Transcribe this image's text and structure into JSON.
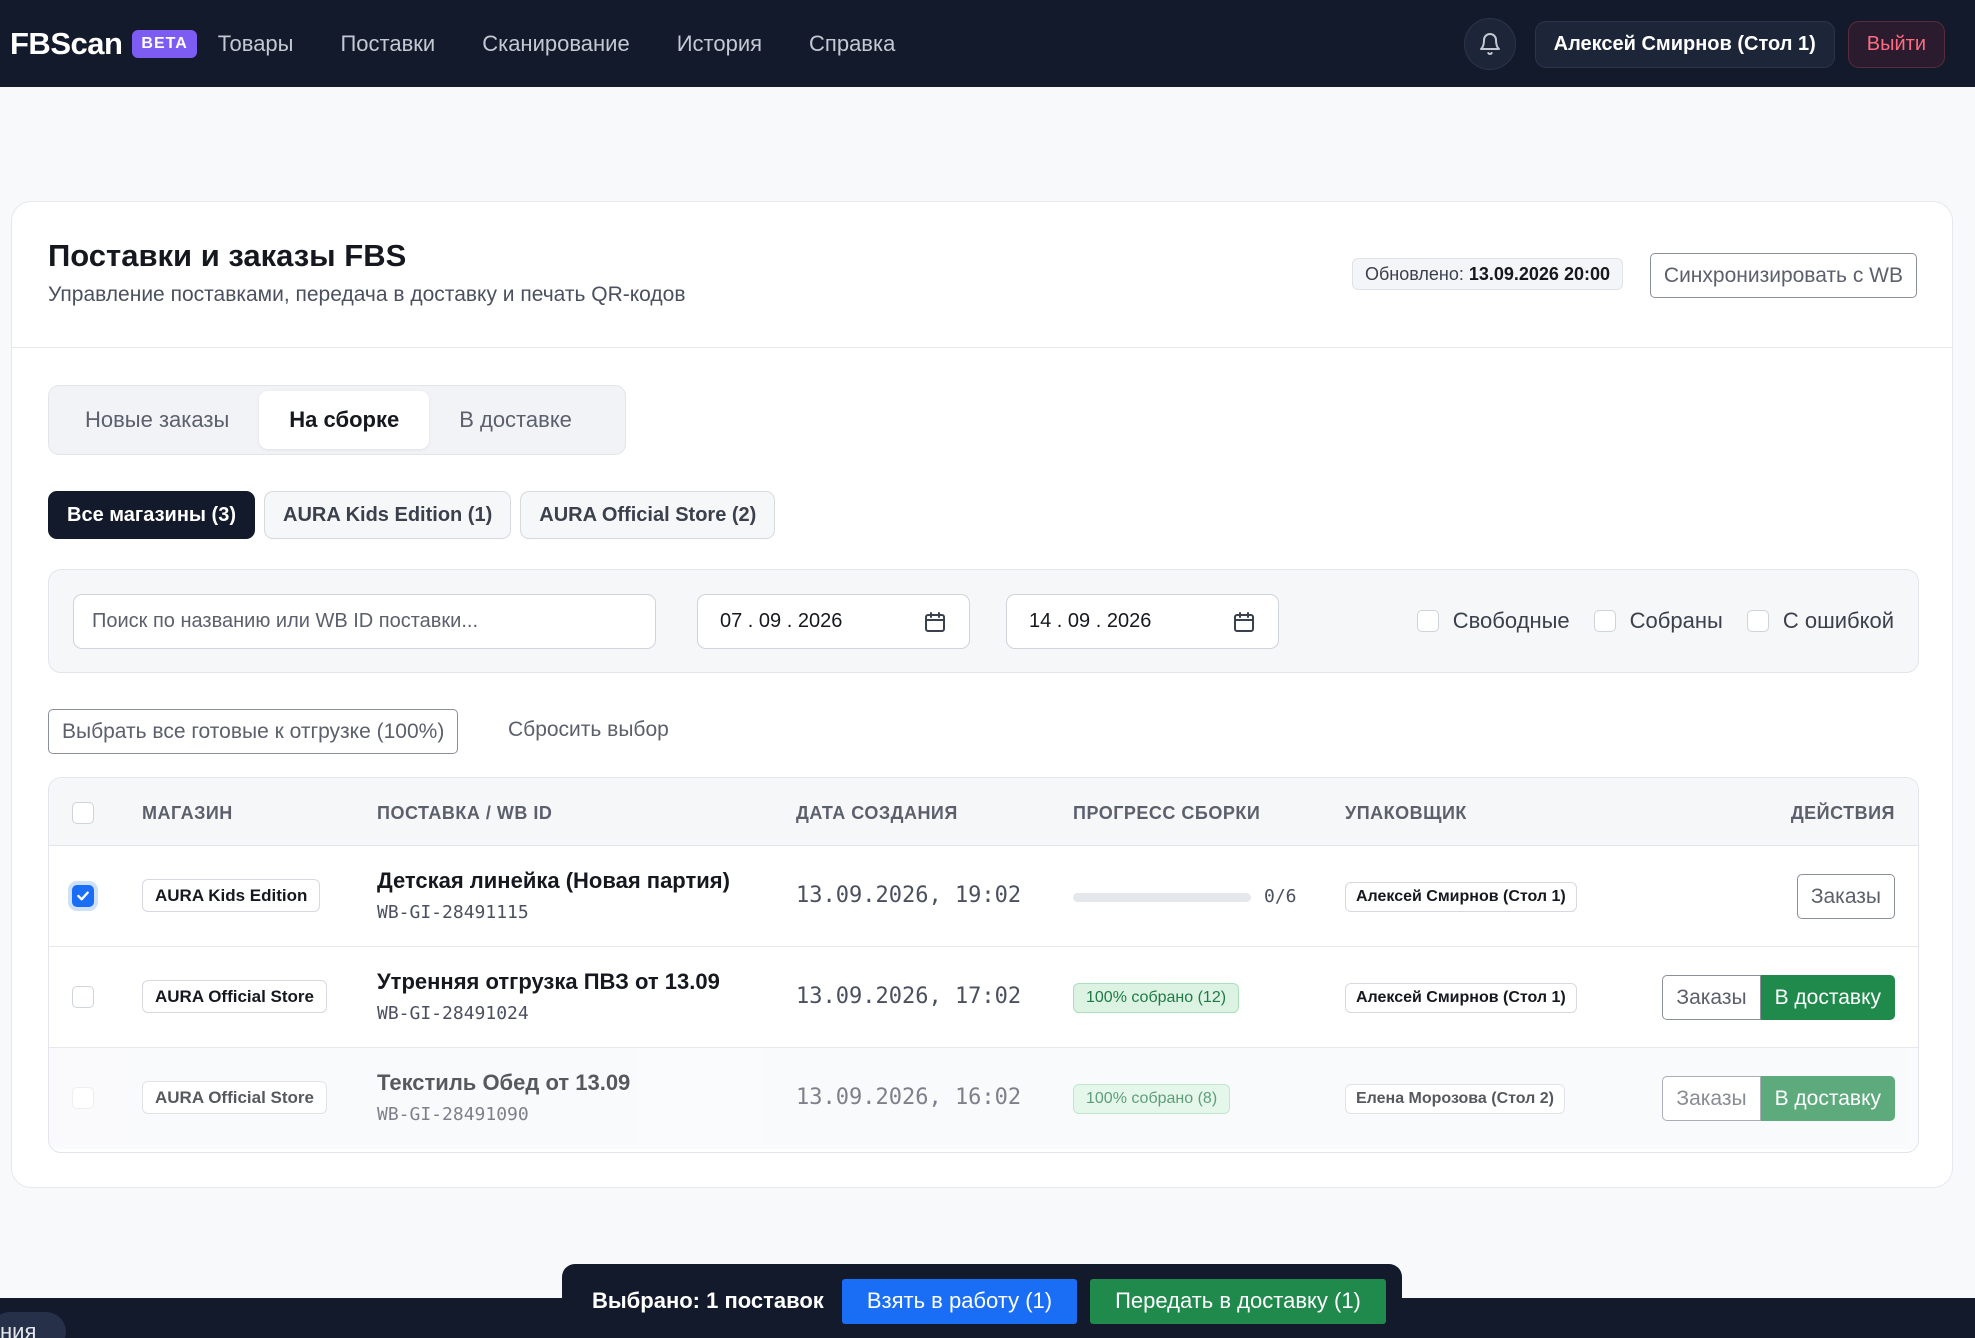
{
  "nav": {
    "brand": "FBScan",
    "beta": "BETA",
    "links": [
      "Товары",
      "Поставки",
      "Сканирование",
      "История",
      "Справка"
    ],
    "user": "Алексей Смирнов (Стол 1)",
    "logout": "Выйти"
  },
  "header": {
    "title": "Поставки и заказы FBS",
    "subtitle": "Управление поставками, передача в доставку и печать QR-кодов",
    "updated_label": "Обновлено:",
    "updated_value": "13.09.2026 20:00",
    "sync_button": "Синхронизировать с WB"
  },
  "tabs": [
    {
      "label": "Новые заказы",
      "active": false
    },
    {
      "label": "На сборке",
      "active": true
    },
    {
      "label": "В доставке",
      "active": false
    }
  ],
  "stores": [
    {
      "label": "Все магазины (3)",
      "active": true
    },
    {
      "label": "AURA Kids Edition (1)",
      "active": false
    },
    {
      "label": "AURA Official Store (2)",
      "active": false
    }
  ],
  "filters": {
    "search_placeholder": "Поиск по названию или WB ID поставки...",
    "date_from": "07 . 09 . 2026",
    "date_to": "14 . 09 . 2026",
    "checkboxes": [
      "Свободные",
      "Собраны",
      "С ошибкой"
    ]
  },
  "bulk": {
    "select_ready": "Выбрать все готовые к отгрузке (100%)",
    "reset": "Сбросить выбор"
  },
  "table": {
    "headers": {
      "store": "МАГАЗИН",
      "shipment": "ПОСТАВКА / WB ID",
      "created": "ДАТА СОЗДАНИЯ",
      "progress": "ПРОГРЕСС СБОРКИ",
      "packer": "УПАКОВЩИК",
      "actions": "ДЕЙСТВИЯ"
    },
    "rows": [
      {
        "checked": true,
        "store": "AURA Kids Edition",
        "name": "Детская линейка (Новая партия)",
        "wb_id": "WB-GI-28491115",
        "created": "13.09.2026, 19:02",
        "progress_text": "0/6",
        "progress_fraction": 0,
        "packer": "Алексей Смирнов (Стол 1)",
        "orders_btn": "Заказы"
      },
      {
        "checked": false,
        "store": "AURA Official Store",
        "name": "Утренняя отгрузка ПВЗ от 13.09",
        "wb_id": "WB-GI-28491024",
        "created": "13.09.2026, 17:02",
        "progress_badge": "100% собрано (12)",
        "progress_fraction": 1,
        "packer": "Алексей Смирнов (Стол 1)",
        "orders_btn": "Заказы",
        "deliver_btn": "В доставку"
      },
      {
        "checked": false,
        "store": "AURA Official Store",
        "name": "Текстиль Обед от 13.09",
        "wb_id": "WB-GI-28491090",
        "created": "13.09.2026, 16:02",
        "progress_badge": "100% собрано (8)",
        "progress_fraction": 1,
        "packer": "Елена Морозова (Стол 2)",
        "orders_btn": "Заказы",
        "deliver_btn": "В доставку"
      }
    ]
  },
  "bottom_bar": {
    "selected": "Выбрано: 1 поставок",
    "take": "Взять в работу (1)",
    "deliver": "Передать в доставку (1)",
    "pill_text": "ния"
  },
  "colors": {
    "nav_bg": "#131a2b",
    "accent_blue": "#1a6ef5",
    "success_green": "#1f8a4c",
    "beta_purple": "#7c5cf2",
    "logout_red": "#ff6b81"
  }
}
